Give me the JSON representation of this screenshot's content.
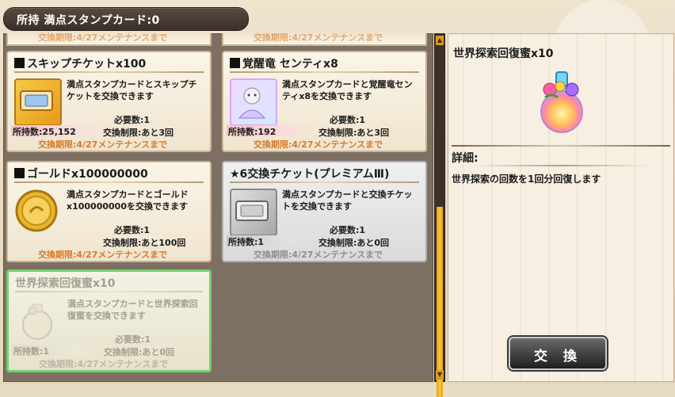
{
  "header": {
    "label": "所持 満点スタンプカード:0"
  },
  "top_partial": [
    {
      "period": "交換期限:4/27メンテナンスまで"
    },
    {
      "period": "交換期限:4/27メンテナンスまで"
    }
  ],
  "items": [
    {
      "title": "スキップチケットx100",
      "desc": "満点スタンプカードとスキップチケットを交換できます",
      "required": "必要数:1",
      "owned": "所持数:25,152",
      "limit": "交換制限:あと3回",
      "period": "交換期限:4/27メンテナンスまで",
      "thumb": "ticket-icon"
    },
    {
      "title": "覚醒竜 センティx8",
      "desc": "満点スタンプカードと覚醒竜センティx8を交換できます",
      "required": "必要数:1",
      "owned": "所持数:192",
      "limit": "交換制限:あと3回",
      "period": "交換期限:4/27メンテナンスまで",
      "thumb": "dragon-portrait-icon"
    },
    {
      "title": "ゴールドx100000000",
      "desc": "満点スタンプカードとゴールドx100000000を交換できます",
      "required": "必要数:1",
      "owned": "",
      "limit": "交換制限:あと100回",
      "period": "交換期限:4/27メンテナンスまで",
      "thumb": "gold-coin-icon"
    },
    {
      "title": "★6交換チケット(プレミアムⅢ)",
      "desc": "満点スタンプカードと交換チケットを交換できます",
      "required": "必要数:1",
      "owned": "所持数:1",
      "limit": "交換制限:あと0回",
      "period": "交換期限:4/27メンテナンスまで",
      "thumb": "exchange-ticket-icon"
    },
    {
      "title": "世界探索回復蜜x10",
      "desc": "満点スタンプカードと世界探索回復蜜を交換できます",
      "required": "必要数:1",
      "owned": "所持数:1",
      "limit": "交換制限:あと0回",
      "period": "交換期限:4/27メンテナンスまで",
      "thumb": "honey-bottle-icon"
    }
  ],
  "detail": {
    "title": "世界探索回復蜜x10",
    "heading": "詳細:",
    "desc": "世界探索の回数を1回分回復します",
    "button": "交換"
  },
  "colors": {
    "accent_orange": "#d77a2a",
    "selected_border": "#6fd36c",
    "scroll_thumb": "#f7c53a"
  }
}
